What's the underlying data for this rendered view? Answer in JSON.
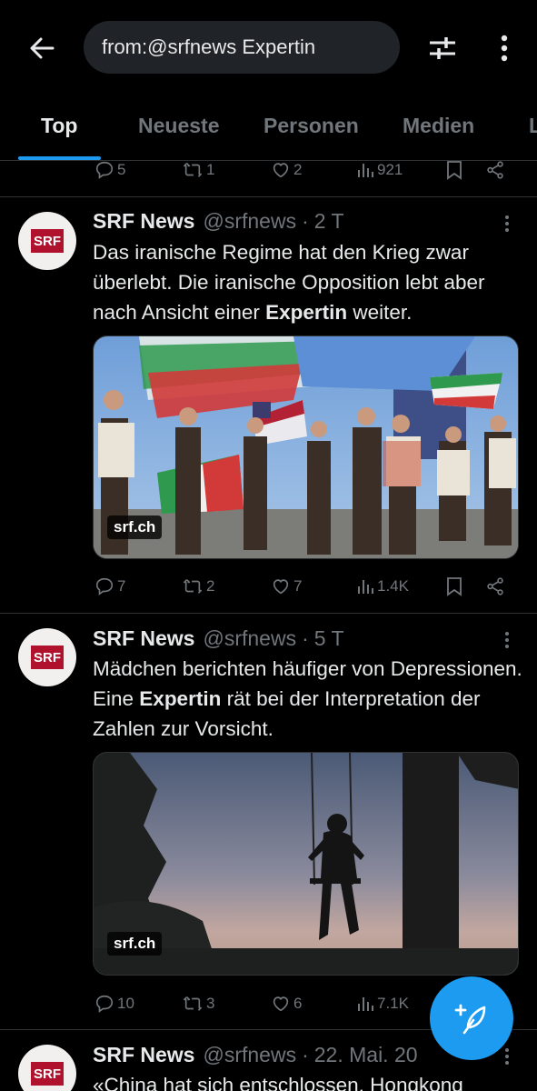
{
  "search": {
    "query": "from:@srfnews Expertin"
  },
  "tabs": [
    {
      "label": "Top"
    },
    {
      "label": "Neueste"
    },
    {
      "label": "Personen"
    },
    {
      "label": "Medien"
    },
    {
      "label": "L"
    }
  ],
  "top_actions": {
    "replies": "5",
    "retweets": "1",
    "likes": "2",
    "views": "921"
  },
  "tweets": [
    {
      "name": "SRF News",
      "handle": "@srfnews",
      "time": "2 T",
      "text_before": "Das iranische Regime hat den Krieg zwar überlebt. Die iranische Opposition lebt aber nach Ansicht einer ",
      "text_bold": "Expertin",
      "text_after": " weiter.",
      "media_source": "srf.ch",
      "replies": "7",
      "retweets": "2",
      "likes": "7",
      "views": "1.4K"
    },
    {
      "name": "SRF News",
      "handle": "@srfnews",
      "time": "5 T",
      "text_before": "Mädchen berichten häufiger von Depressionen. Eine ",
      "text_bold": "Expertin",
      "text_after": " rät bei der Interpretation der Zahlen zur Vorsicht.",
      "media_source": "srf.ch",
      "replies": "10",
      "retweets": "3",
      "likes": "6",
      "views": "7.1K"
    },
    {
      "name": "SRF News",
      "handle": "@srfnews",
      "time": "22. Mai. 20",
      "text_partial": "«China hat sich entschlossen, Hongkong"
    }
  ],
  "avatar_logo": "SRF",
  "colors": {
    "accent": "#1d9bf0",
    "muted": "#71767b",
    "text": "#e7e9ea",
    "divider": "#2f3336",
    "srf_red": "#b0112d"
  },
  "icons": [
    "back-arrow-icon",
    "filter-sliders-icon",
    "more-vertical-icon",
    "reply-icon",
    "retweet-icon",
    "like-icon",
    "views-icon",
    "bookmark-icon",
    "share-icon",
    "compose-feather-icon"
  ]
}
